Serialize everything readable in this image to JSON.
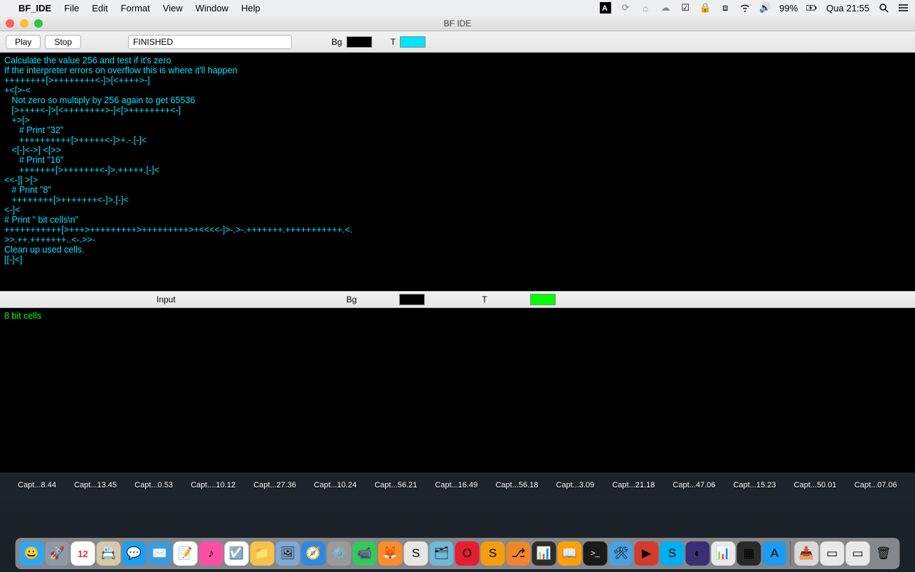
{
  "menubar": {
    "app": "BF_IDE",
    "items": [
      "File",
      "Edit",
      "Format",
      "View",
      "Window",
      "Help"
    ],
    "battery": "99%",
    "clock": "Qua 21:55"
  },
  "window": {
    "title": "BF IDE",
    "play": "Play",
    "stop": "Stop",
    "status": "FINISHED",
    "bg1_label": "Bg",
    "t1_label": "T",
    "bg1_color": "#000000",
    "t1_color": "#00e5ff",
    "input_label": "Input",
    "bg2_label": "Bg",
    "t2_label": "T",
    "bg2_color": "#000000",
    "t2_color": "#00ff00"
  },
  "editor_code": "Calculate the value 256 and test if it's zero\nIf the interpreter errors on overflow this is where it'll happen\n++++++++[>++++++++<-]>[<++++>-]\n+<[>-<\n   Not zero so multiply by 256 again to get 65536\n   [>++++<-]>[<++++++++>-]<[>++++++++<-]\n   +>[>\n      # Print \"32\"\n      ++++++++++[>+++++<-]>+.-.[-]<\n   <[-]<->] <[>>\n      # Print \"16\"\n      +++++++[>+++++++<-]>.+++++.[-]<\n<<-]] >[>\n   # Print \"8\"\n   ++++++++[>+++++++<-]>.[-]<\n<-]<\n# Print \" bit cells\\n\"\n+++++++++++[>+++>+++++++++>+++++++++>+<<<<-]>-.>-.+++++++.+++++++++++.<.\n>>.++.+++++++..<-.>>-\nClean up used cells.\n[[-]<]",
  "output_text": "8 bit cells",
  "desktop_files": [
    "Capt...8.44",
    "Capt...13.45",
    "Capt...0.53",
    "Capt....10.12",
    "Capt...27.36",
    "Capt...10.24",
    "Capt...56.21",
    "Capt...16.49",
    "Capt...56.18",
    "Capt...3.09",
    "Capt...21.18",
    "Capt...47.06",
    "Capt...15.23",
    "Capt...50.01",
    "Capt...07.06"
  ],
  "dock": [
    {
      "name": "finder",
      "bg": "#2aa8f6",
      "g": "😀"
    },
    {
      "name": "launchpad",
      "bg": "#8e9aa7",
      "g": "🚀"
    },
    {
      "name": "calendar",
      "bg": "#ffffff",
      "g": "12"
    },
    {
      "name": "contacts",
      "bg": "#d9c7a6",
      "g": "📇"
    },
    {
      "name": "messages",
      "bg": "#1ba1f2",
      "g": "💬"
    },
    {
      "name": "mail",
      "bg": "#3d9bdc",
      "g": "✉️"
    },
    {
      "name": "notes",
      "bg": "#fdfdfd",
      "g": "📝"
    },
    {
      "name": "itunes",
      "bg": "#ff4fa2",
      "g": "♪"
    },
    {
      "name": "reminders",
      "bg": "#fdfdfd",
      "g": "☑️"
    },
    {
      "name": "folder",
      "bg": "#f6c24b",
      "g": "📁"
    },
    {
      "name": "preview",
      "bg": "#7fa9d4",
      "g": "🖼"
    },
    {
      "name": "safari",
      "bg": "#2c89e8",
      "g": "🧭"
    },
    {
      "name": "settings",
      "bg": "#9a9a9a",
      "g": "⚙️"
    },
    {
      "name": "facetime",
      "bg": "#34c759",
      "g": "📹"
    },
    {
      "name": "firefox",
      "bg": "#ff8b2a",
      "g": "🦊"
    },
    {
      "name": "app1",
      "bg": "#e6e6e6",
      "g": "S"
    },
    {
      "name": "app2",
      "bg": "#6fbad7",
      "g": "🗂"
    },
    {
      "name": "opera",
      "bg": "#e71c2f",
      "g": "O"
    },
    {
      "name": "sublime",
      "bg": "#f59e0b",
      "g": "S"
    },
    {
      "name": "app3",
      "bg": "#f0862a",
      "g": "⎇"
    },
    {
      "name": "activity",
      "bg": "#2c2c2c",
      "g": "📊"
    },
    {
      "name": "books",
      "bg": "#ff9f0a",
      "g": "📖"
    },
    {
      "name": "terminal",
      "bg": "#1a1a1a",
      "g": ">_"
    },
    {
      "name": "preview2",
      "bg": "#4aa0e0",
      "g": "🛠"
    },
    {
      "name": "app4",
      "bg": "#d43b2f",
      "g": "▶"
    },
    {
      "name": "skype",
      "bg": "#00aff0",
      "g": "S"
    },
    {
      "name": "eclipse",
      "bg": "#3a2f72",
      "g": "◐"
    },
    {
      "name": "numbers",
      "bg": "#e9e9e9",
      "g": "📊"
    },
    {
      "name": "app5",
      "bg": "#2a2a2a",
      "g": "▦"
    },
    {
      "name": "appstore",
      "bg": "#1d9bf0",
      "g": "A"
    }
  ],
  "dock_right": [
    {
      "name": "downloads",
      "bg": "#d9d9d9",
      "g": "📥"
    },
    {
      "name": "stack1",
      "bg": "#e9e9e9",
      "g": "▭"
    },
    {
      "name": "stack2",
      "bg": "#e9e9e9",
      "g": "▭"
    },
    {
      "name": "trash",
      "bg": "transparent",
      "g": "🗑"
    }
  ]
}
